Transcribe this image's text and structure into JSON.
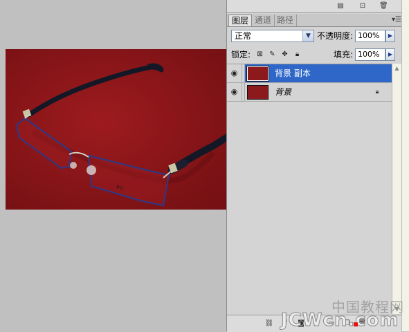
{
  "canvas": {
    "photo_icon": "eyeglasses-photo",
    "background_color": "#8a1518"
  },
  "panel": {
    "topbar_icons": [
      "layer-comp-icon",
      "camera-icon",
      "trash-icon"
    ],
    "tabs": [
      {
        "label": "图层",
        "active": true
      },
      {
        "label": "通道",
        "active": false
      },
      {
        "label": "路径",
        "active": false
      }
    ],
    "menu_icon": "panel-menu-icon",
    "blend_mode": "正常",
    "opacity_label": "不透明度:",
    "opacity_value": "100%",
    "lock_label": "锁定:",
    "lock_icons": [
      "lock-transparent-icon",
      "lock-brush-icon",
      "lock-move-icon",
      "lock-all-icon"
    ],
    "fill_label": "填充:",
    "fill_value": "100%",
    "accent_color": "#2f67c8",
    "layers": [
      {
        "name": "背景 副本",
        "selected": true,
        "visible": true,
        "locked": false
      },
      {
        "name": "背景",
        "selected": false,
        "visible": true,
        "locked": true
      }
    ],
    "bottom_icons": [
      "link-layers-icon",
      "layer-style-icon",
      "mask-icon",
      "adjustment-icon",
      "group-icon",
      "new-layer-icon",
      "trash-icon"
    ]
  },
  "watermark": {
    "cn": "中国教程网",
    "en": "JCWcn.com"
  }
}
